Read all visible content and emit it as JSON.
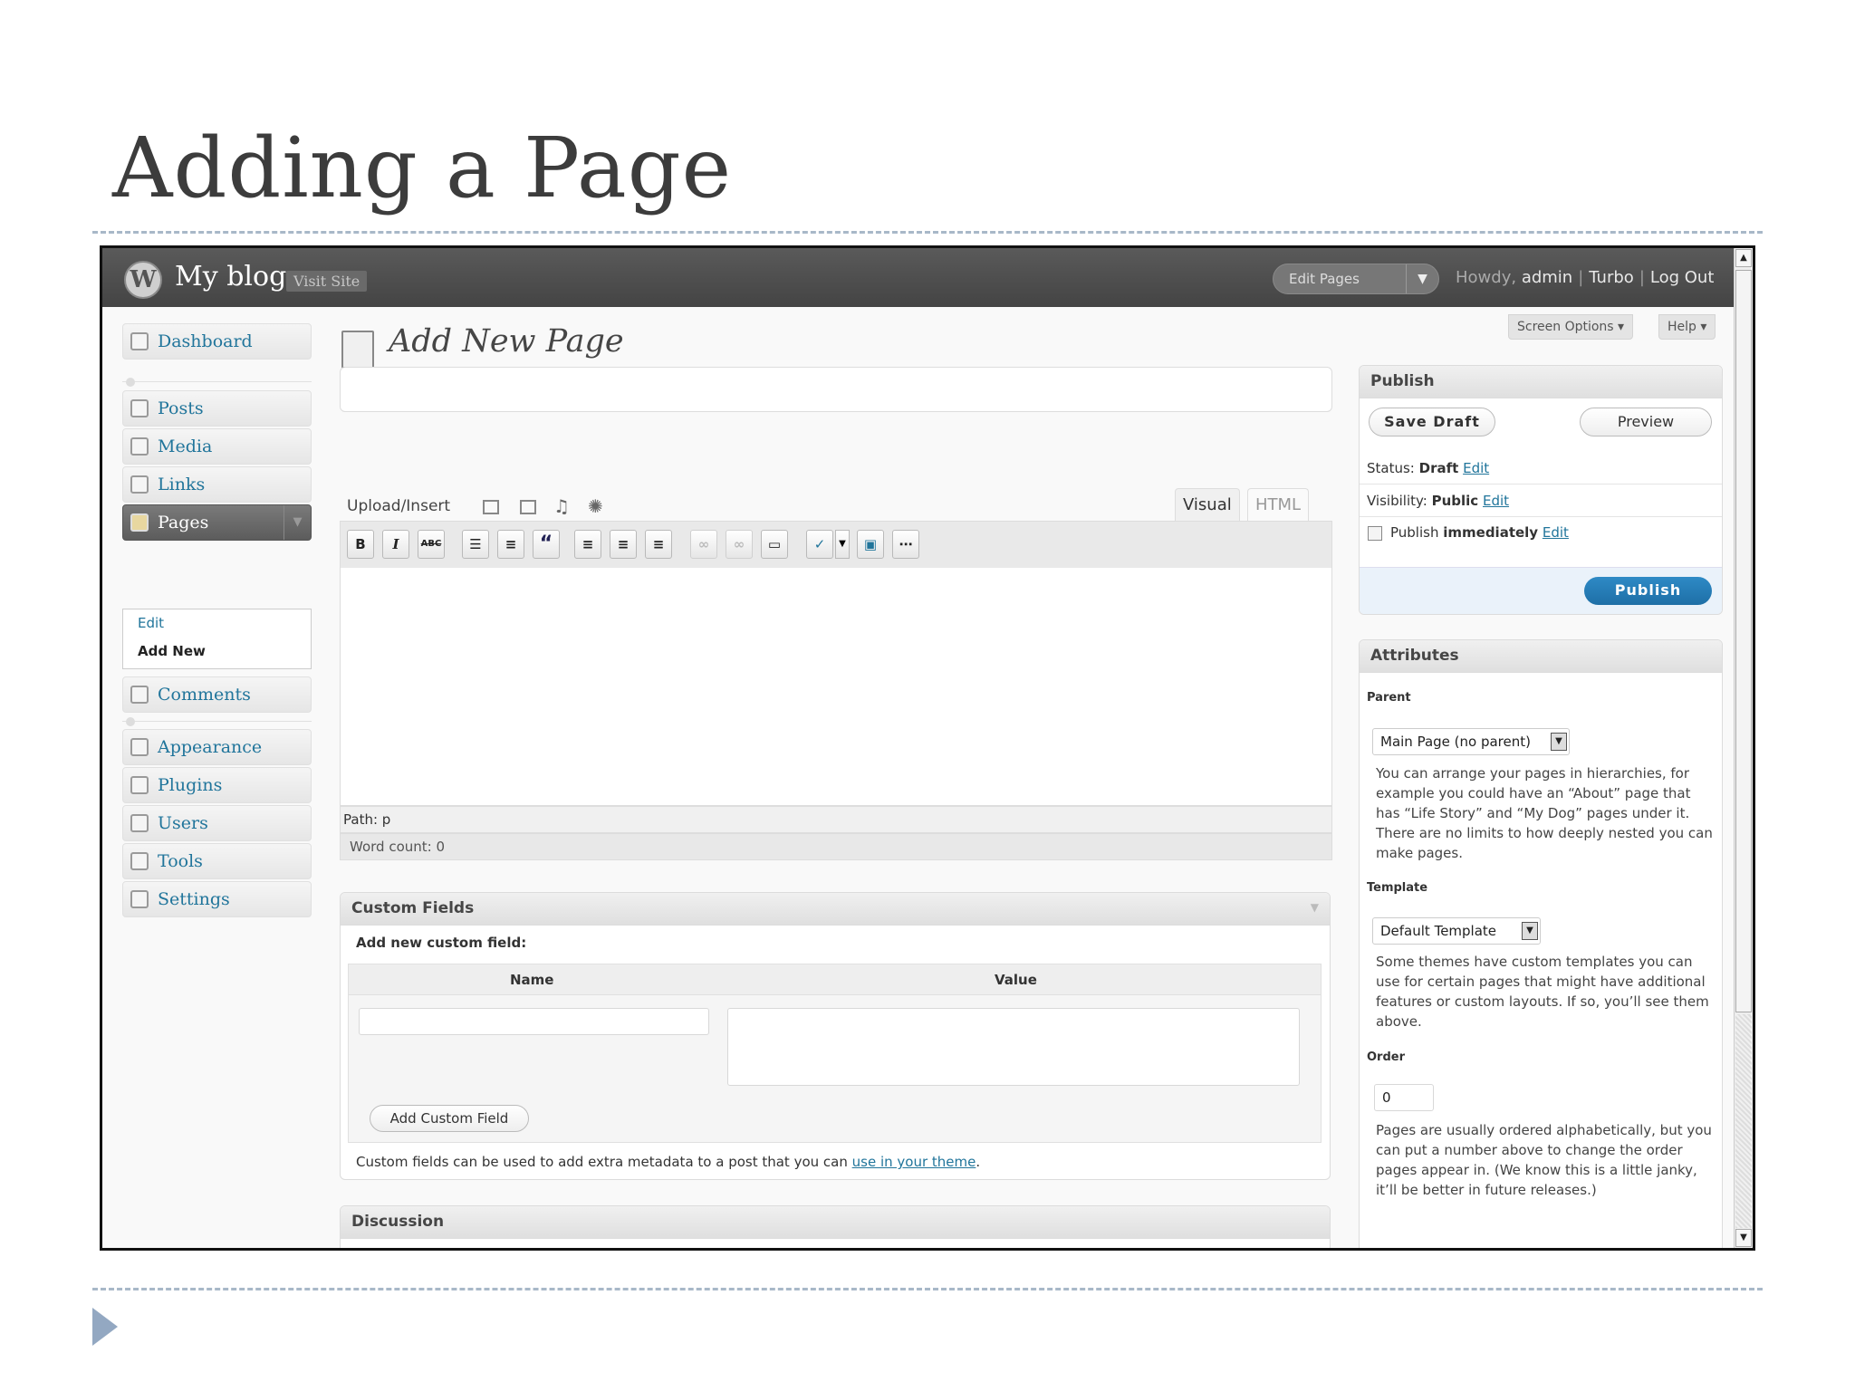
{
  "slide": {
    "title": "Adding a Page"
  },
  "adminbar": {
    "logo_glyph": "W",
    "blog_name": "My blog",
    "visit_site": "Visit Site",
    "edit_pages": "Edit Pages",
    "howdy": "Howdy,",
    "user": "admin",
    "turbo": "Turbo",
    "logout": "Log Out"
  },
  "screen_options": "Screen Options",
  "help": "Help",
  "menu": {
    "dashboard": "Dashboard",
    "posts": "Posts",
    "media": "Media",
    "links": "Links",
    "pages": "Pages",
    "pages_edit": "Edit",
    "pages_add_new": "Add New",
    "comments": "Comments",
    "appearance": "Appearance",
    "plugins": "Plugins",
    "users": "Users",
    "tools": "Tools",
    "settings": "Settings"
  },
  "page_heading": "Add New Page",
  "editor": {
    "upload_insert": "Upload/Insert",
    "tab_visual": "Visual",
    "tab_html": "HTML",
    "btn_bold": "B",
    "btn_italic": "I",
    "btn_strike": "ABC",
    "btn_quote": "“",
    "path": "Path: p",
    "word_count": "Word count: 0"
  },
  "custom_fields": {
    "title": "Custom Fields",
    "add_new": "Add new custom field:",
    "col_name": "Name",
    "col_value": "Value",
    "add_button": "Add Custom Field",
    "note_before": "Custom fields can be used to add extra metadata to a post that you can",
    "note_link": "use in your theme",
    "note_after": "."
  },
  "discussion": {
    "title": "Discussion"
  },
  "publish": {
    "title": "Publish",
    "save_draft": "Save Draft",
    "preview": "Preview",
    "status_label": "Status:",
    "status_value": "Draft",
    "visibility_label": "Visibility:",
    "visibility_value": "Public",
    "publish_label": "Publish",
    "publish_value": "immediately",
    "edit": "Edit",
    "publish_button": "Publish"
  },
  "attributes": {
    "title": "Attributes",
    "parent_label": "Parent",
    "parent_value": "Main Page (no parent)",
    "parent_help": "You can arrange your pages in hierarchies, for example you could have an “About” page that has “Life Story” and “My Dog” pages under it. There are no limits to how deeply nested you can make pages.",
    "template_label": "Template",
    "template_value": "Default Template",
    "template_help": "Some themes have custom templates you can use for certain pages that might have additional features or custom layouts. If so, you’ll see them above.",
    "order_label": "Order",
    "order_value": "0",
    "order_help": "Pages are usually ordered alphabetically, but you can put a number above to change the order pages appear in. (We know this is a little janky, it’ll be better in future releases.)"
  },
  "colors": {
    "accent": "#21759b",
    "publish_button": "#1e6fa6",
    "admin_bar": "#464646"
  }
}
